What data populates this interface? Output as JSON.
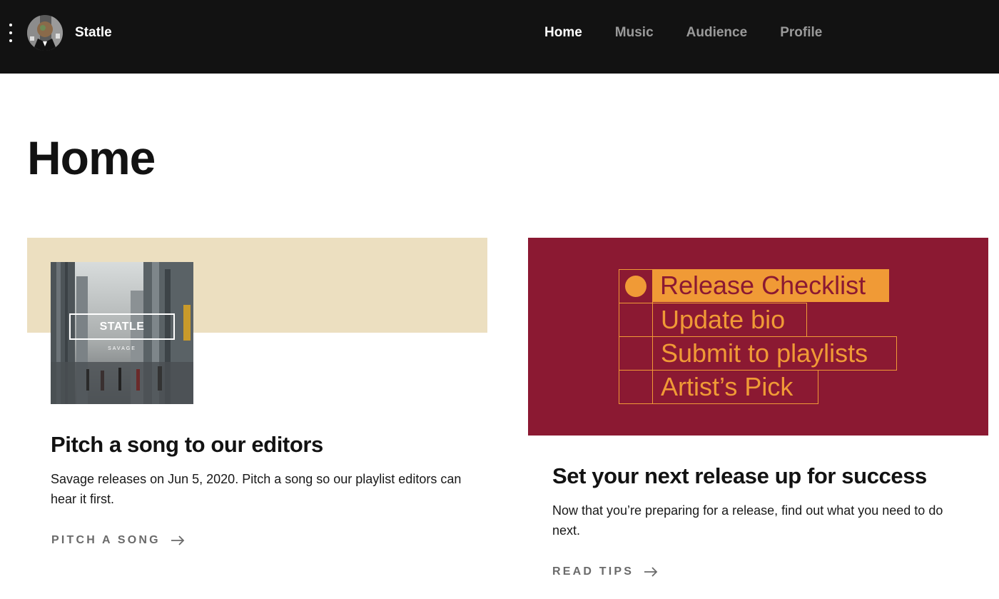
{
  "header": {
    "menu_icon": "more-vertical-icon",
    "artist_name": "Statle",
    "nav": [
      {
        "label": "Home",
        "active": true
      },
      {
        "label": "Music",
        "active": false
      },
      {
        "label": "Audience",
        "active": false
      },
      {
        "label": "Profile",
        "active": false
      }
    ]
  },
  "page": {
    "title": "Home"
  },
  "pitch_card": {
    "cover": {
      "title": "STATLE",
      "subtitle": "SAVAGE"
    },
    "title": "Pitch a song to our editors",
    "description": "Savage releases on Jun 5, 2020. Pitch a song so our playlist editors can hear it first.",
    "link_label": "PITCH A SONG",
    "band_color": "#ecdfc0"
  },
  "release_card": {
    "checklist": [
      "Release Checklist",
      "Update bio",
      "Submit to playlists",
      "Artist’s Pick"
    ],
    "title": "Set your next release up for success",
    "description": "Now that you’re preparing for a release, find out what you need to do next.",
    "link_label": "READ TIPS",
    "background_color": "#8b1932",
    "accent_color": "#f09a36"
  },
  "colors": {
    "topbar": "#121212",
    "nav_active": "#ffffff",
    "nav_inactive": "#9a9a9a",
    "link": "#6a6a6a"
  }
}
